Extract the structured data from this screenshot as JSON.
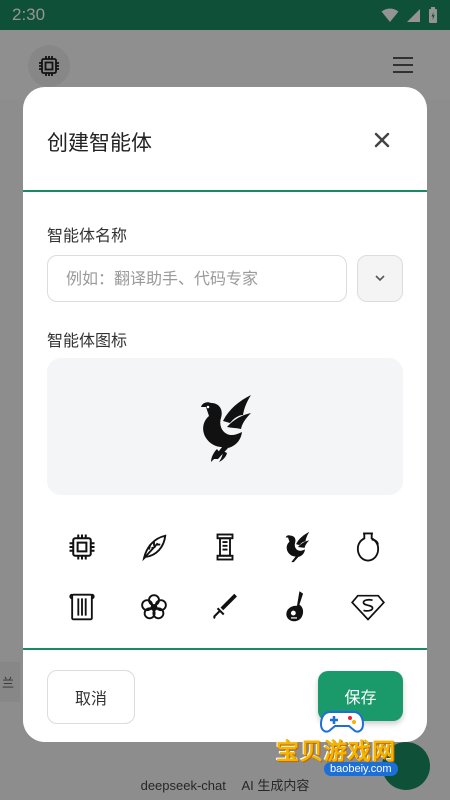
{
  "status_bar": {
    "time": "2:30"
  },
  "background": {
    "left_peek_text": "兰",
    "bottom_model": "deepseek-chat",
    "bottom_note": "AI 生成内容"
  },
  "modal": {
    "title": "创建智能体",
    "name_label": "智能体名称",
    "name_placeholder": "例如：翻译助手、代码专家",
    "name_value": "",
    "icon_label": "智能体图标",
    "selected_icon": "phoenix-icon",
    "icons_row1": [
      "chip-icon",
      "leaf-icon",
      "scroll-pillar-icon",
      "phoenix-icon",
      "vase-icon"
    ],
    "icons_row2": [
      "scroll-icon",
      "plum-blossom-icon",
      "sword-icon",
      "pipa-icon",
      "superman-icon"
    ],
    "cancel_label": "取消",
    "save_label": "保存"
  },
  "watermark": {
    "text": "宝贝游戏网",
    "url": "baobeiy.com"
  },
  "colors": {
    "accent": "#1a8a62",
    "save": "#1a9a6a",
    "preview_bg": "#f4f5f7"
  }
}
